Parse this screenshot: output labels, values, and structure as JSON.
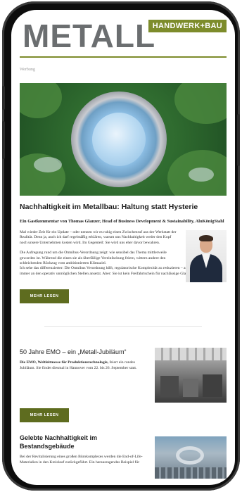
{
  "brand": {
    "logo": "METALL",
    "tag": "HANDWERK+BAU",
    "accent": "#7d8c2b"
  },
  "ad_label": "Werbung",
  "article": {
    "title": "Nachhaltigkeit im Metallbau: Haltung statt Hysterie",
    "byline": "Ein Gastkommentar von Thomas Glanzer, Head of Business Development & Sustainability, AluKönigStahl",
    "paragraphs": [
      "Mal wieder Zeit für ein Update – oder nennen wir es ruhig einen Zwischenruf aus der Werkstatt der Realität. Denn ja, auch ich darf regelmäßig erklären, warum uns Nachhaltigkeit weder den Kopf noch unsere Unternehmen kosten wird. Im Gegenteil: Sie wird uns eher davor bewahren.",
      "Die Aufregung rund um die Omnibus-Verordnung zeigt: wie sensibel das Thema mittlerweile geworden ist. Während die einen sie als überfällige Vereinfachung feiern, wittern andere den schleichenden Rückzug vom ambitionierten Klimaziel.",
      "Ich sehe das differenzierter: Die Omnibus Verordnung hilft, regulatorische Komplexität zu reduzieren – auch wenn sie dabei nicht immer an den operativ unmöglichen Stellen ansetzt. Aber: Sie ist kein Freifahrtschein für nachlässige Glaubwürdigkeit."
    ],
    "button": "MEHR LESEN"
  },
  "item2": {
    "title": "50 Jahre EMO – ein „Metall-Jubiläum“",
    "text_bold": "Die EMO, Weltleitmesse für Produktionstechnologie,",
    "text": " feiert ein rundes Jubiläum. Sie findet diesmal in Hannover vom 22. bis 26. September statt.",
    "button": "MEHR LESEN"
  },
  "item3": {
    "title": "Gelebte Nachhaltigkeit im Bestandsgebäude",
    "text": "Bei der Revitalisierung eines großen Bürokomplexes werden die End-of-Life-Materialien in den Kreislauf zurückgeführt. Ein herausragendes Beispiel für"
  }
}
